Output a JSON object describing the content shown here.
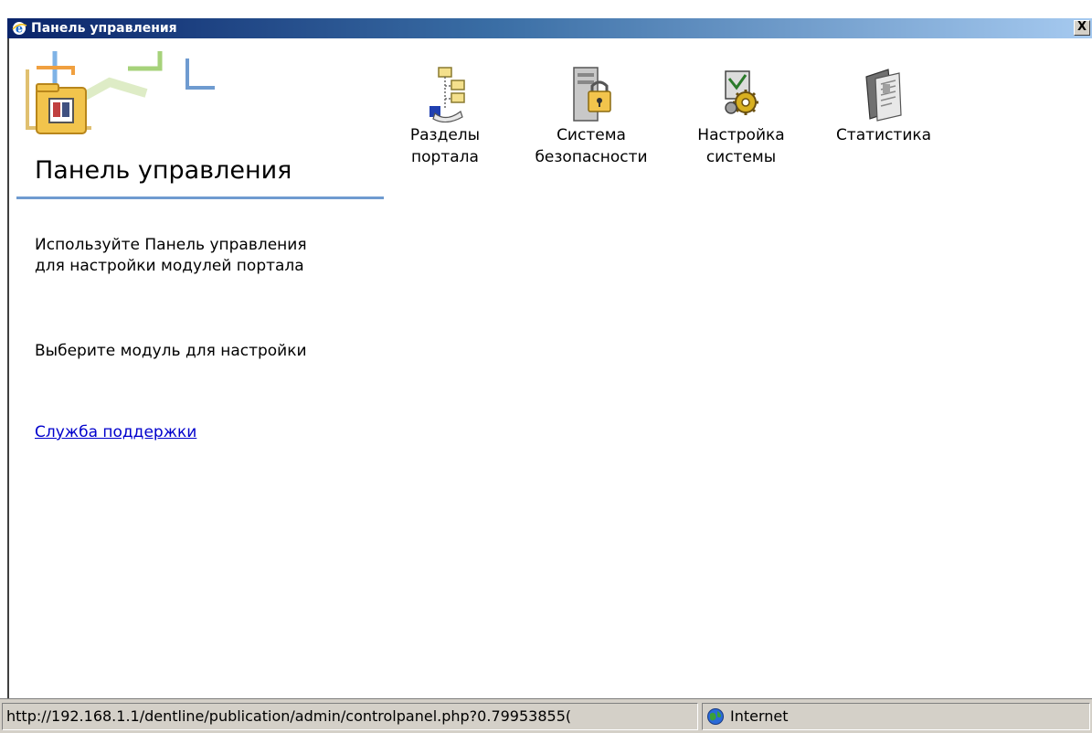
{
  "window": {
    "title": "Панель управления",
    "close_label": "X",
    "title_bar_color": "#0a246a"
  },
  "sidebar": {
    "heading": "Панель управления",
    "intro": "Используйте Панель управления для настройки модулей портала",
    "choose": "Выберите модуль для настройки",
    "support_link": "Служба поддержки",
    "link_color": "#0000cc"
  },
  "modules": [
    {
      "label": "Разделы\nпортала",
      "icon": "portal-sections-icon"
    },
    {
      "label": "Система\nбезопасности",
      "icon": "security-lock-icon"
    },
    {
      "label": "Настройка\nсистемы",
      "icon": "system-settings-icon"
    },
    {
      "label": "Статистика",
      "icon": "statistics-icon"
    }
  ],
  "statusbar": {
    "url": "http://192.168.1.1/dentline/publication/admin/controlpanel.php?0.79953855(",
    "zone": "Internet",
    "zone_icon": "globe-icon"
  }
}
